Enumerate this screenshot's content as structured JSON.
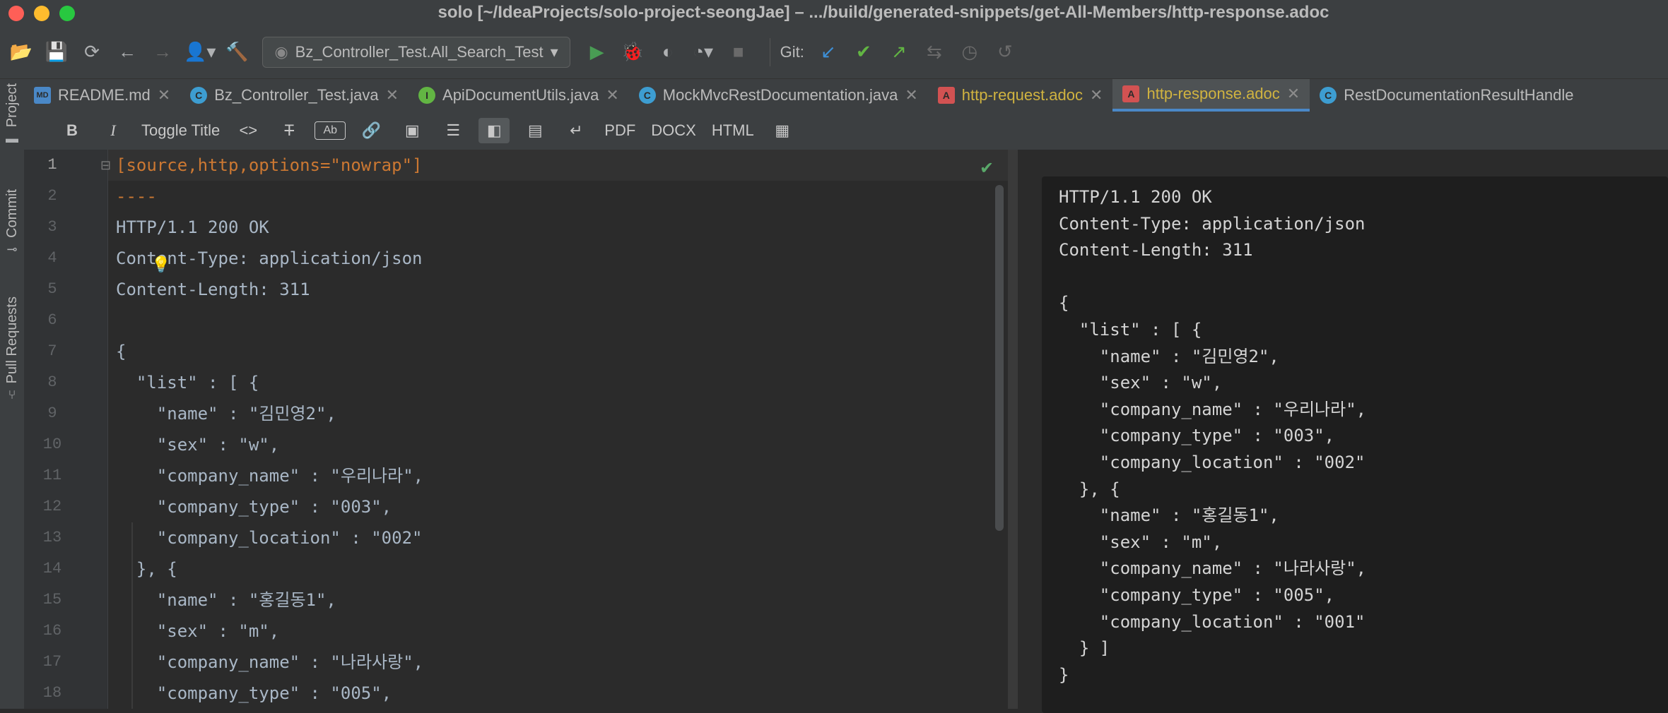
{
  "window": {
    "title": "solo [~/IdeaProjects/solo-project-seongJae] – .../build/generated-snippets/get-All-Members/http-response.adoc"
  },
  "colors": {
    "close": "#fe5f57",
    "minimize": "#febc2e",
    "maximize": "#28c840",
    "accent": "#4a88c7",
    "keyword": "#cc7832"
  },
  "toolbar": {
    "run_config": "Bz_Controller_Test.All_Search_Test",
    "git_label": "Git:"
  },
  "sidebar": {
    "items": [
      "Project",
      "Commit",
      "Pull Requests"
    ]
  },
  "tabs": [
    {
      "label": "README.md",
      "icon": "MD",
      "color": "#4a88c7",
      "active": false
    },
    {
      "label": "Bz_Controller_Test.java",
      "icon": "C",
      "color": "#3d9dd1",
      "active": false
    },
    {
      "label": "ApiDocumentUtils.java",
      "icon": "I",
      "color": "#62b543",
      "active": false
    },
    {
      "label": "MockMvcRestDocumentation.java",
      "icon": "C",
      "color": "#3d9dd1",
      "active": false
    },
    {
      "label": "http-request.adoc",
      "icon": "A",
      "color": "#d25252",
      "active": false
    },
    {
      "label": "http-response.adoc",
      "icon": "A",
      "color": "#d25252",
      "active": true
    },
    {
      "label": "RestDocumentationResultHandle",
      "icon": "C",
      "color": "#3d9dd1",
      "active": false
    }
  ],
  "format_bar": {
    "toggle_title": "Toggle Title",
    "pdf": "PDF",
    "docx": "DOCX",
    "html": "HTML"
  },
  "editor": {
    "line_numbers": [
      "1",
      "2",
      "3",
      "4",
      "5",
      "6",
      "7",
      "8",
      "9",
      "10",
      "11",
      "12",
      "13",
      "14",
      "15",
      "16",
      "17",
      "18"
    ],
    "lines": [
      "[source,http,options=\"nowrap\"]",
      "----",
      "HTTP/1.1 200 OK",
      "Content-Type: application/json",
      "Content-Length: 311",
      "",
      "{",
      "  \"list\" : [ {",
      "    \"name\" : \"김민영2\",",
      "    \"sex\" : \"w\",",
      "    \"company_name\" : \"우리나라\",",
      "    \"company_type\" : \"003\",",
      "    \"company_location\" : \"002\"",
      "  }, {",
      "    \"name\" : \"홍길동1\",",
      "    \"sex\" : \"m\",",
      "    \"company_name\" : \"나라사랑\",",
      "    \"company_type\" : \"005\","
    ]
  },
  "preview": {
    "lines": [
      "HTTP/1.1 200 OK",
      "Content-Type: application/json",
      "Content-Length: 311",
      "",
      "{",
      "  \"list\" : [ {",
      "    \"name\" : \"김민영2\",",
      "    \"sex\" : \"w\",",
      "    \"company_name\" : \"우리나라\",",
      "    \"company_type\" : \"003\",",
      "    \"company_location\" : \"002\"",
      "  }, {",
      "    \"name\" : \"홍길동1\",",
      "    \"sex\" : \"m\",",
      "    \"company_name\" : \"나라사랑\",",
      "    \"company_type\" : \"005\",",
      "    \"company_location\" : \"001\"",
      "  } ]",
      "}"
    ]
  }
}
